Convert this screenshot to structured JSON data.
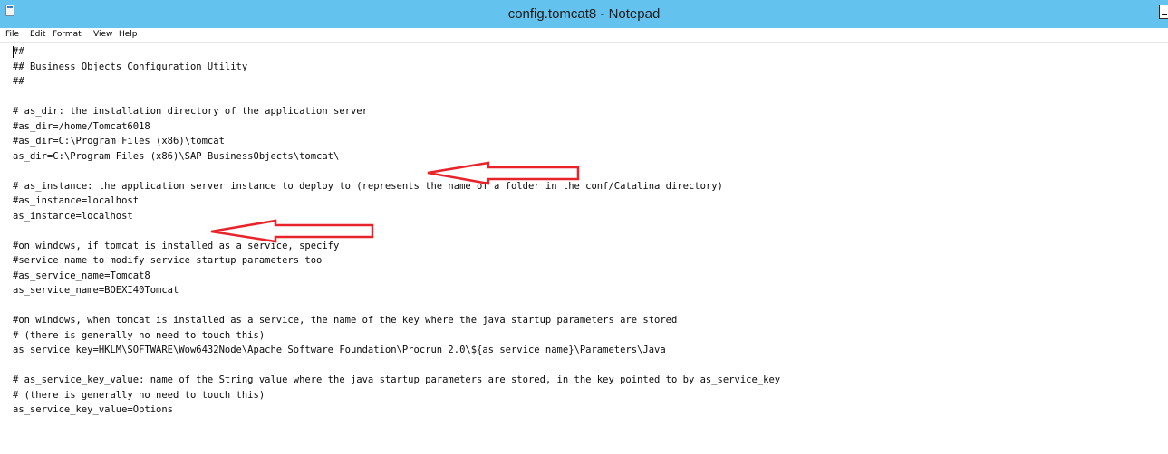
{
  "window": {
    "title": "config.tomcat8 - Notepad"
  },
  "menu": {
    "file": "File",
    "edit": "Edit",
    "format": "Format",
    "view": "View",
    "help": "Help"
  },
  "editor": {
    "lines": [
      "##",
      "## Business Objects Configuration Utility",
      "##",
      "",
      "# as_dir: the installation directory of the application server",
      "#as_dir=/home/Tomcat6018",
      "#as_dir=C:\\Program Files (x86)\\tomcat",
      "as_dir=C:\\Program Files (x86)\\SAP BusinessObjects\\tomcat\\",
      "",
      "# as_instance: the application server instance to deploy to (represents the name of a folder in the conf/Catalina directory)",
      "#as_instance=localhost",
      "as_instance=localhost",
      "",
      "#on windows, if tomcat is installed as a service, specify",
      "#service name to modify service startup parameters too",
      "#as_service_name=Tomcat8",
      "as_service_name=BOEXI40Tomcat",
      "",
      "#on windows, when tomcat is installed as a service, the name of the key where the java startup parameters are stored",
      "# (there is generally no need to touch this)",
      "as_service_key=HKLM\\SOFTWARE\\Wow6432Node\\Apache Software Foundation\\Procrun 2.0\\${as_service_name}\\Parameters\\Java",
      "",
      "# as_service_key_value: name of the String value where the java startup parameters are stored, in the key pointed to by as_service_key",
      "# (there is generally no need to touch this)",
      "as_service_key_value=Options"
    ]
  },
  "colors": {
    "titlebar": "#63c2ee",
    "annotation_arrow": "#e8242a"
  },
  "icons": {
    "app": "notepad-icon",
    "minimize": "minimize-icon",
    "arrow": "red-arrow-left-icon"
  }
}
